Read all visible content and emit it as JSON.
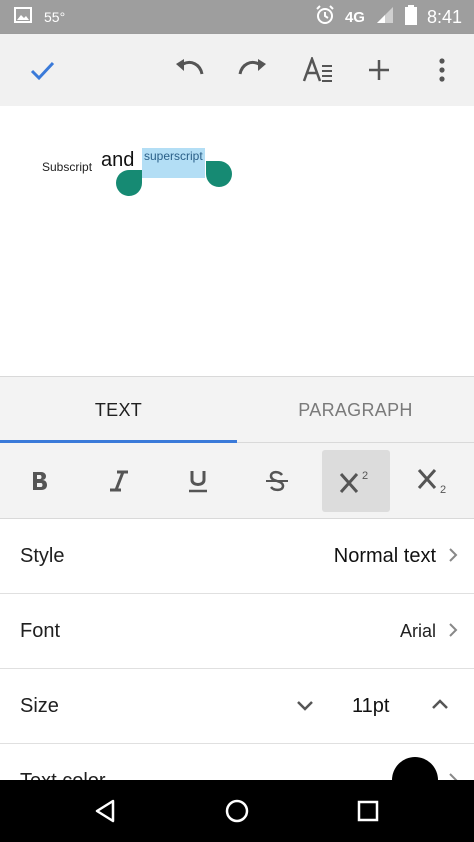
{
  "status_bar": {
    "temperature": "55°",
    "network": "4G",
    "time": "8:41"
  },
  "toolbar": {
    "icons": [
      "check-icon",
      "undo-icon",
      "redo-icon",
      "text-format-icon",
      "add-icon",
      "more-vert-icon"
    ]
  },
  "document": {
    "subscript_text": "Subscript",
    "and_text": "and",
    "superscript_text": "superscript"
  },
  "format_panel": {
    "tabs": [
      {
        "label": "TEXT",
        "active": true
      },
      {
        "label": "PARAGRAPH",
        "active": false
      }
    ],
    "format_buttons": [
      {
        "name": "bold",
        "active": false
      },
      {
        "name": "italic",
        "active": false
      },
      {
        "name": "underline",
        "active": false
      },
      {
        "name": "strikethrough",
        "active": false
      },
      {
        "name": "superscript",
        "active": true
      },
      {
        "name": "subscript",
        "active": false
      }
    ],
    "rows": {
      "style": {
        "label": "Style",
        "value": "Normal text"
      },
      "font": {
        "label": "Font",
        "value": "Arial"
      },
      "size": {
        "label": "Size",
        "value": "11pt"
      },
      "text_color": {
        "label": "Text color"
      }
    }
  },
  "colors": {
    "accent": "#3a7ad9",
    "selection": "#b3def5",
    "handle": "#168a73"
  }
}
